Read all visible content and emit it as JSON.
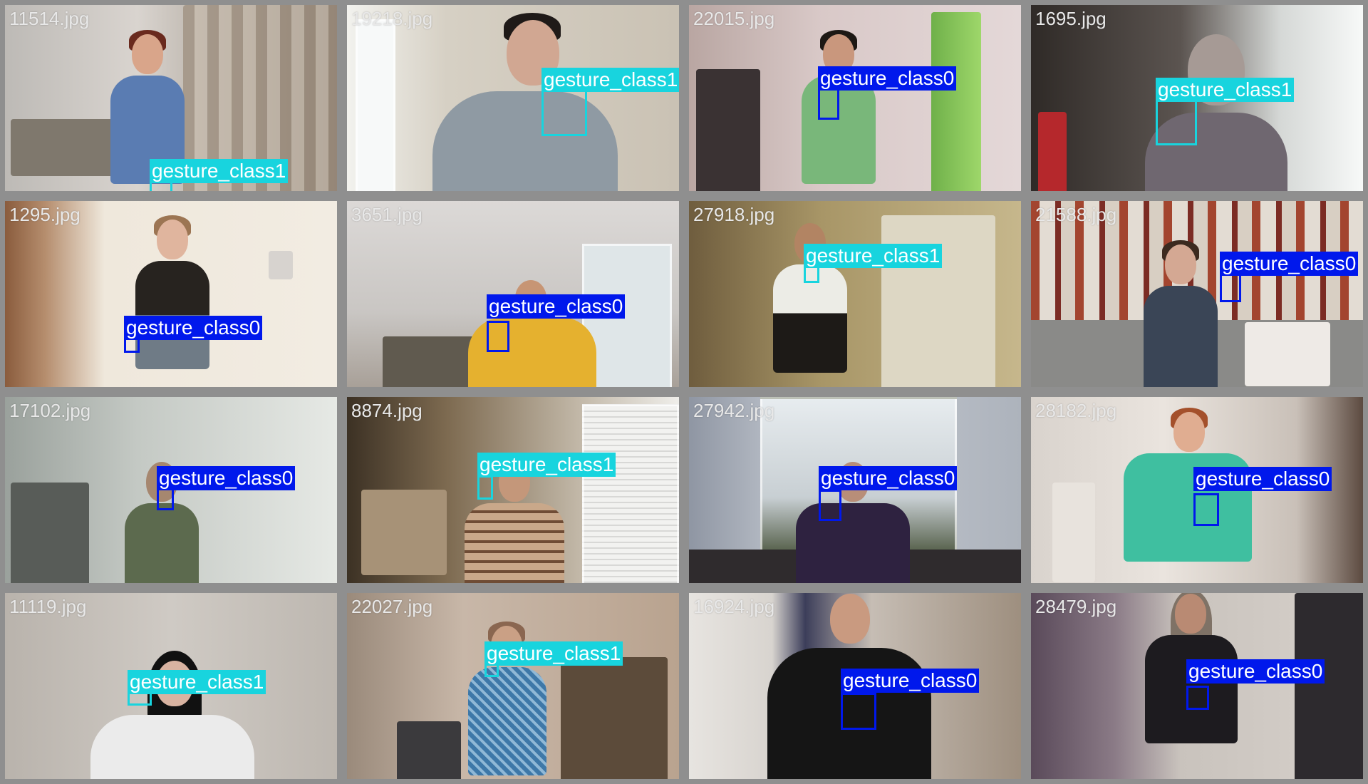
{
  "colors": {
    "gesture_class0": "#0018ec",
    "gesture_class1": "#18d4de",
    "tile_border": "#8f8f8f"
  },
  "tiles": [
    {
      "filename": "11514.jpg",
      "label": "gesture_class1",
      "scene": "bedroom-curtains"
    },
    {
      "filename": "19218.jpg",
      "label": "gesture_class1",
      "scene": "closeup-man-glasses"
    },
    {
      "filename": "22015.jpg",
      "label": "gesture_class0",
      "scene": "room-green-curtain"
    },
    {
      "filename": "1695.jpg",
      "label": "gesture_class1",
      "scene": "bright-window"
    },
    {
      "filename": "1295.jpg",
      "label": "gesture_class0",
      "scene": "hallway-woman"
    },
    {
      "filename": "3651.jpg",
      "label": "gesture_class0",
      "scene": "room-yellow-shirt"
    },
    {
      "filename": "27918.jpg",
      "label": "gesture_class1",
      "scene": "kitchen-fridge"
    },
    {
      "filename": "21588.jpg",
      "label": "gesture_class0",
      "scene": "striped-wallpaper"
    },
    {
      "filename": "17102.jpg",
      "label": "gesture_class0",
      "scene": "bright-glass-door"
    },
    {
      "filename": "8874.jpg",
      "label": "gesture_class1",
      "scene": "kitchen-blinds"
    },
    {
      "filename": "27942.jpg",
      "label": "gesture_class0",
      "scene": "dark-window"
    },
    {
      "filename": "28182.jpg",
      "label": "gesture_class0",
      "scene": "teal-shirt"
    },
    {
      "filename": "11119.jpg",
      "label": "gesture_class1",
      "scene": "woman-white-shirt"
    },
    {
      "filename": "22027.jpg",
      "label": "gesture_class1",
      "scene": "room-dress"
    },
    {
      "filename": "16924.jpg",
      "label": "gesture_class0",
      "scene": "man-black-tshirt"
    },
    {
      "filename": "28479.jpg",
      "label": "gesture_class0",
      "scene": "man-tank-top"
    }
  ]
}
